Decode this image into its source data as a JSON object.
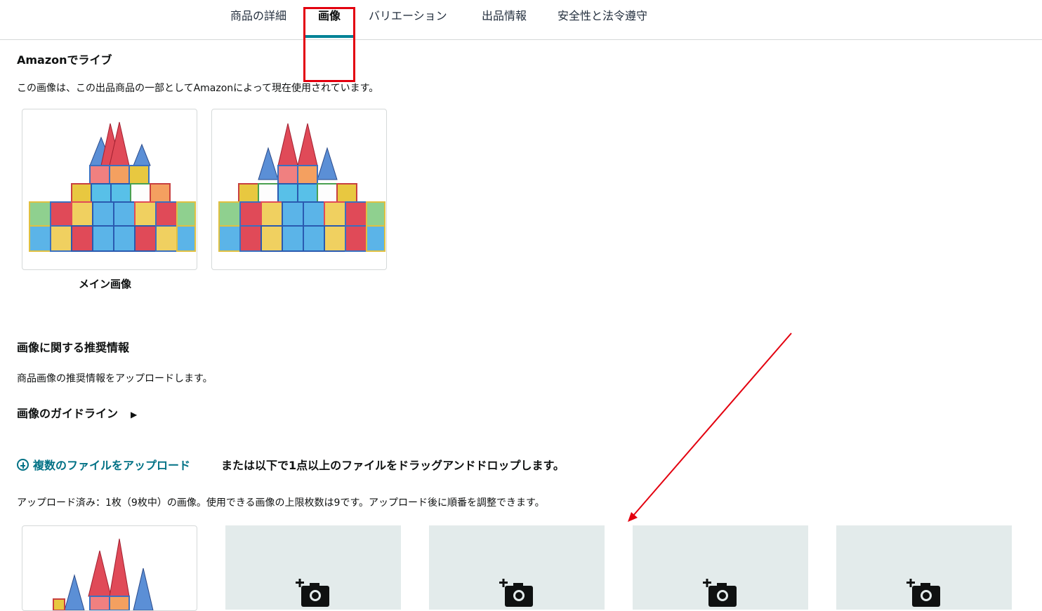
{
  "tabs": [
    {
      "label": "商品の詳細"
    },
    {
      "label": "画像"
    },
    {
      "label": "バリエーション"
    },
    {
      "label": "出品情報"
    },
    {
      "label": "安全性と法令遵守"
    }
  ],
  "live": {
    "title": "Amazonでライブ",
    "description": "この画像は、この出品商品の一部としてAmazonによって現在使用されています。",
    "main_caption": "メイン画像"
  },
  "recommend": {
    "title": "画像に関する推奨情報",
    "description": "商品画像の推奨情報をアップロードします。",
    "guidelines_label": "画像のガイドライン"
  },
  "upload": {
    "link_label": "複数のファイルをアップロード",
    "drop_text": "または以下で1点以上のファイルをドラッグアンドドロップします。",
    "status": "アップロード済み：1枚（9枚中）の画像。使用できる画像の上限枚数は9です。アップロード後に順番を調整できます。"
  },
  "icons": {
    "guideline": "triangle-right-icon",
    "upload": "plus-circle-icon",
    "placeholder": "add-photo-icon"
  },
  "colors": {
    "accent": "#008296",
    "link": "#007185",
    "annotation": "#e3000f",
    "placeholder_bg": "#e3ebeb"
  }
}
